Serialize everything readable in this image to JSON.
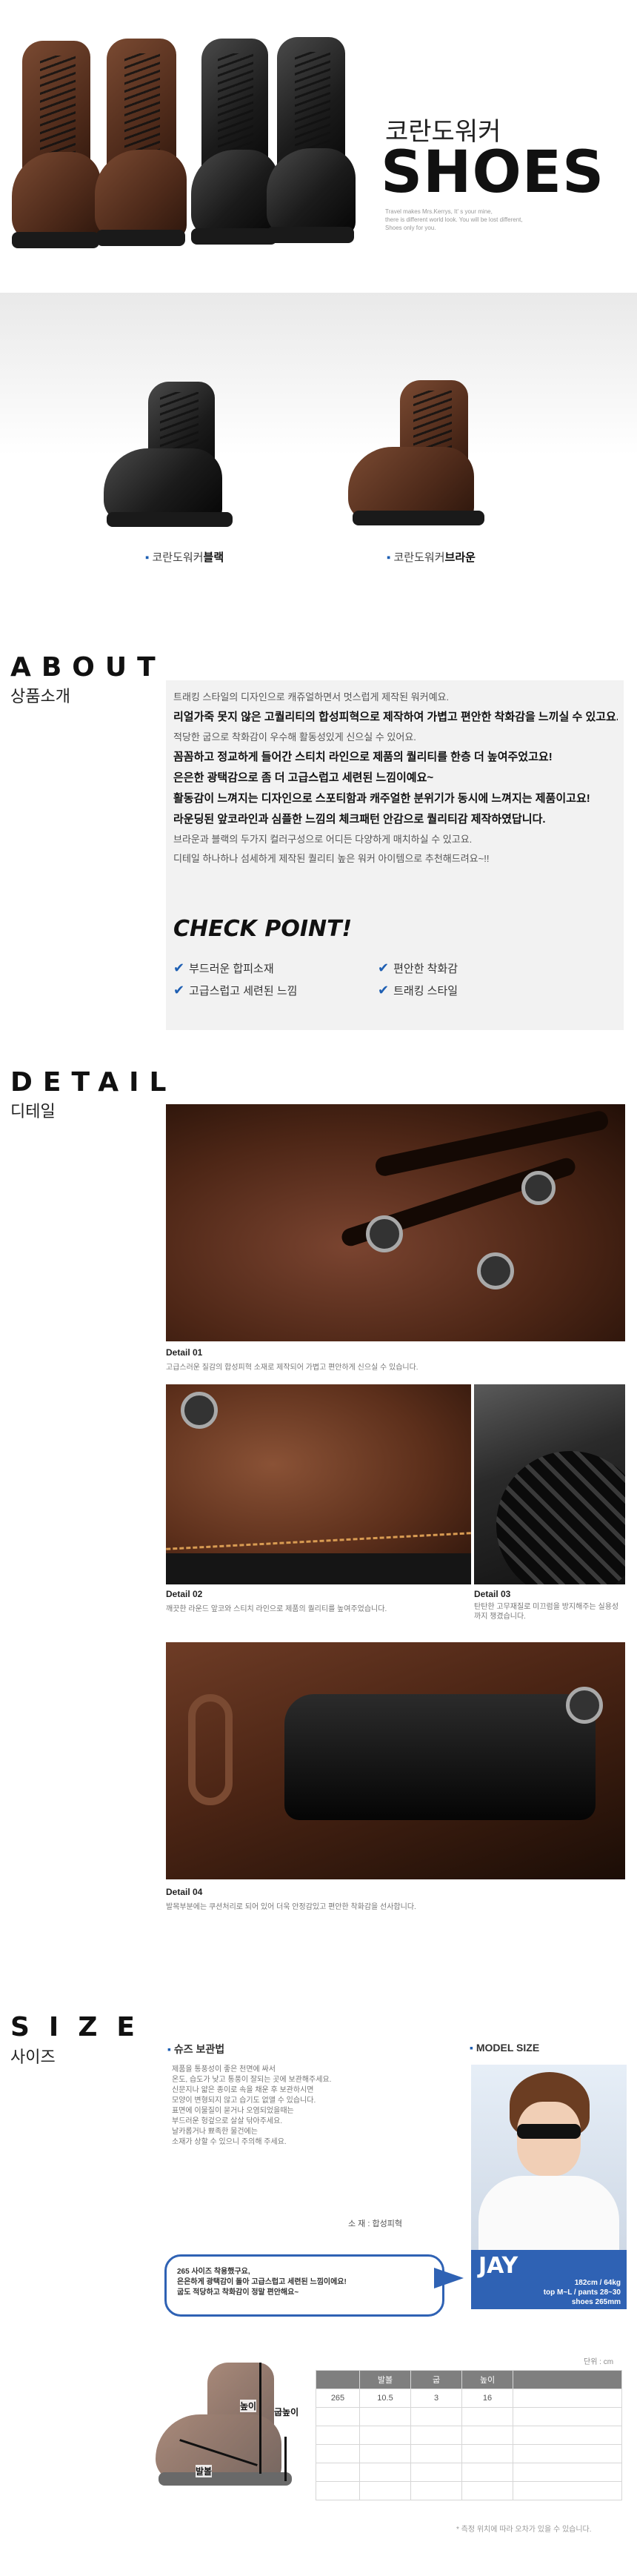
{
  "hero": {
    "title_kr": "코란도워커",
    "title_en": "SHOES",
    "tagline_lines": [
      "Travel makes Mrs.Kerrys, It' s your mine,",
      "there is different world look. You will be lost different,",
      "Shoes only for you."
    ]
  },
  "variants": [
    {
      "label_prefix": "코란도워커",
      "label_color": "블랙"
    },
    {
      "label_prefix": "코란도워커",
      "label_color": "브라운"
    }
  ],
  "about": {
    "title": "ABOUT",
    "subtitle": "상품소개",
    "lines": [
      "트래킹 스타일의 디자인으로 캐쥬얼하면서 멋스럽게 제작된 워커예요.",
      "리얼가죽 못지 않은 고퀄리티의 합성피혁으로 제작하여 가볍고 편안한 착화감을 느끼실 수 있고요.",
      "적당한 굽으로 착화감이 우수해 활동성있게 신으실 수 있어요.",
      "꼼꼼하고 정교하게 들어간 스티치 라인으로 제품의 퀄리티를 한층 더 높여주었고요!",
      "은은한 광택감으로 좀 더 고급스럽고 세련된 느낌이예요~",
      "활동감이 느껴지는 디자인으로 스포티함과 캐주얼한 분위기가 동시에 느껴지는 제품이고요!",
      "라운딩된 앞코라인과 심플한 느낌의 체크패턴 안감으로 퀄리티감 제작하였답니다.",
      "브라운과 블랙의 두가지 컬러구성으로 어디든 다양하게 매치하실 수 있고요.",
      "디테일 하나하나 섬세하게 제작된 퀄리티 높은 워커 아이템으로 추천해드려요~!!"
    ],
    "check_title": "CHECK POINT!",
    "checks": [
      "부드러운 합피소재",
      "편안한 착화감",
      "고급스럽고 세련된 느낌",
      "트래킹 스타일"
    ]
  },
  "detail": {
    "title": "DETAIL",
    "subtitle": "디테일",
    "items": [
      {
        "title": "Detail 01",
        "desc": "고급스러운 질감의 합성피혁 소재로 제작되어 가볍고 편안하게 신으실 수 있습니다."
      },
      {
        "title": "Detail 02",
        "desc": "깨끗한 라운드 앞코와 스티치 라인으로 제품의 퀄리티를 높여주었습니다."
      },
      {
        "title": "Detail 03",
        "desc": "탄탄한 고무재질로 미끄럼을 방지해주는 실용성까지 챙겼습니다."
      },
      {
        "title": "Detail 04",
        "desc": "발목부분에는 쿠션처리로 되어 있어 더욱 안정감있고 편안한 착화감을 선사합니다."
      }
    ]
  },
  "size": {
    "title": "SIZE",
    "subtitle": "사이즈",
    "care_title": "슈즈 보관법",
    "care_lines": [
      "제품을 통풍성이 좋은 천면에 싸서",
      "온도, 습도가 낮고 통풍이 잘되는 곳에 보관해주세요.",
      "신문지나 얇은 종이로 속을 채운 후 보관하시면",
      "모양이 변형되지 않고 습기도 없앨 수 있습니다.",
      "표면에 이물질이 묻거나 오염되었을때는",
      "부드러운 헝겊으로 살살 닦아주세요.",
      "날카롭거나 뾰족한 물건에는",
      "소재가 상할 수 있으니 주의해 주세요."
    ],
    "material_label": "소  재 : 합성피혁",
    "model_title": "MODEL SIZE",
    "model_name": "JAY",
    "model_lines": [
      "182cm / 64kg",
      "top M~L / pants 28~30",
      "shoes 265mm"
    ],
    "callout_lines": [
      "265 사이즈 착용했구요,",
      "은은하게 광택감이 돌아 고급스럽고 세련된 느낌이에요!",
      "굽도 적당하고 착화감이 정말 편안해요~"
    ],
    "unit_label": "단위 : cm",
    "table_header": [
      "",
      "발볼",
      "굽",
      "높이"
    ],
    "table_rows": [
      [
        "265",
        "10.5",
        "3",
        "16"
      ]
    ],
    "diagram_labels": {
      "height": "높이",
      "heel": "굽높이",
      "width": "발볼"
    },
    "footnote": "* 측정 위치에 따라 오차가 있을 수 있습니다."
  },
  "colors": {
    "accent_blue": "#1e5fb3",
    "about_bg": "#f2f2f2",
    "table_header": "#7f7f7f"
  }
}
